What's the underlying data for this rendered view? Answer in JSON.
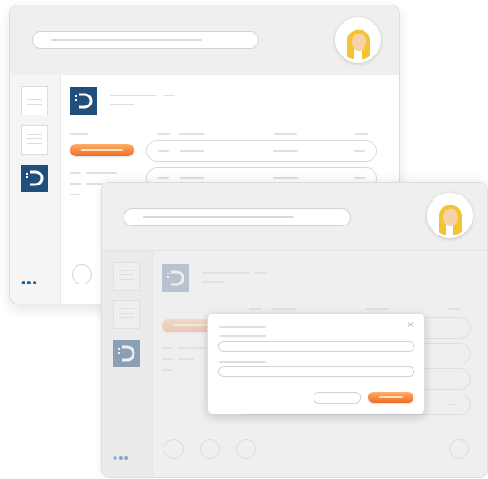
{
  "colors": {
    "accent_blue": "#1f4f7a",
    "primary_button": "#f06a25",
    "menu_dots": "#1f5fa8",
    "header_bg": "#efefef"
  },
  "icons": {
    "avatar": "woman-blonde-avatar-icon",
    "logo": "d-logo-icon",
    "document": "document-icon",
    "more": "more-dots-icon",
    "close": "close-icon"
  },
  "back_window": {
    "menu_dots": "•••"
  },
  "front_window": {
    "menu_dots": "•••",
    "dialog": {
      "close_glyph": "×"
    }
  }
}
